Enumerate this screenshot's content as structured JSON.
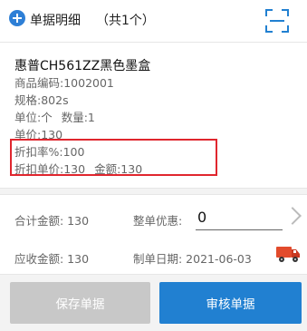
{
  "header": {
    "title": "单据明细",
    "count": "（共1个）"
  },
  "item": {
    "name": "惠普CH561ZZ黑色墨盒",
    "code": "商品编码:1002001",
    "spec": "规格:802s",
    "unit": "单位:个",
    "quantity": "数量:1",
    "price": "单价:130",
    "discount_rate": "折扣率%:100",
    "discount_price": "折扣单价:130",
    "amount": "金额:130"
  },
  "summary": {
    "total_label": "合计金额:  130",
    "discount_label": "整单优惠:",
    "discount_value": "0",
    "receivable_label": "应收金额:  130",
    "date_label": "制单日期:  2021-06-03"
  },
  "buttons": {
    "save": "保存单据",
    "approve": "审核单据"
  },
  "colors": {
    "accent": "#2180d1",
    "highlight": "#e0262e",
    "disabled": "#c8c8c8"
  }
}
